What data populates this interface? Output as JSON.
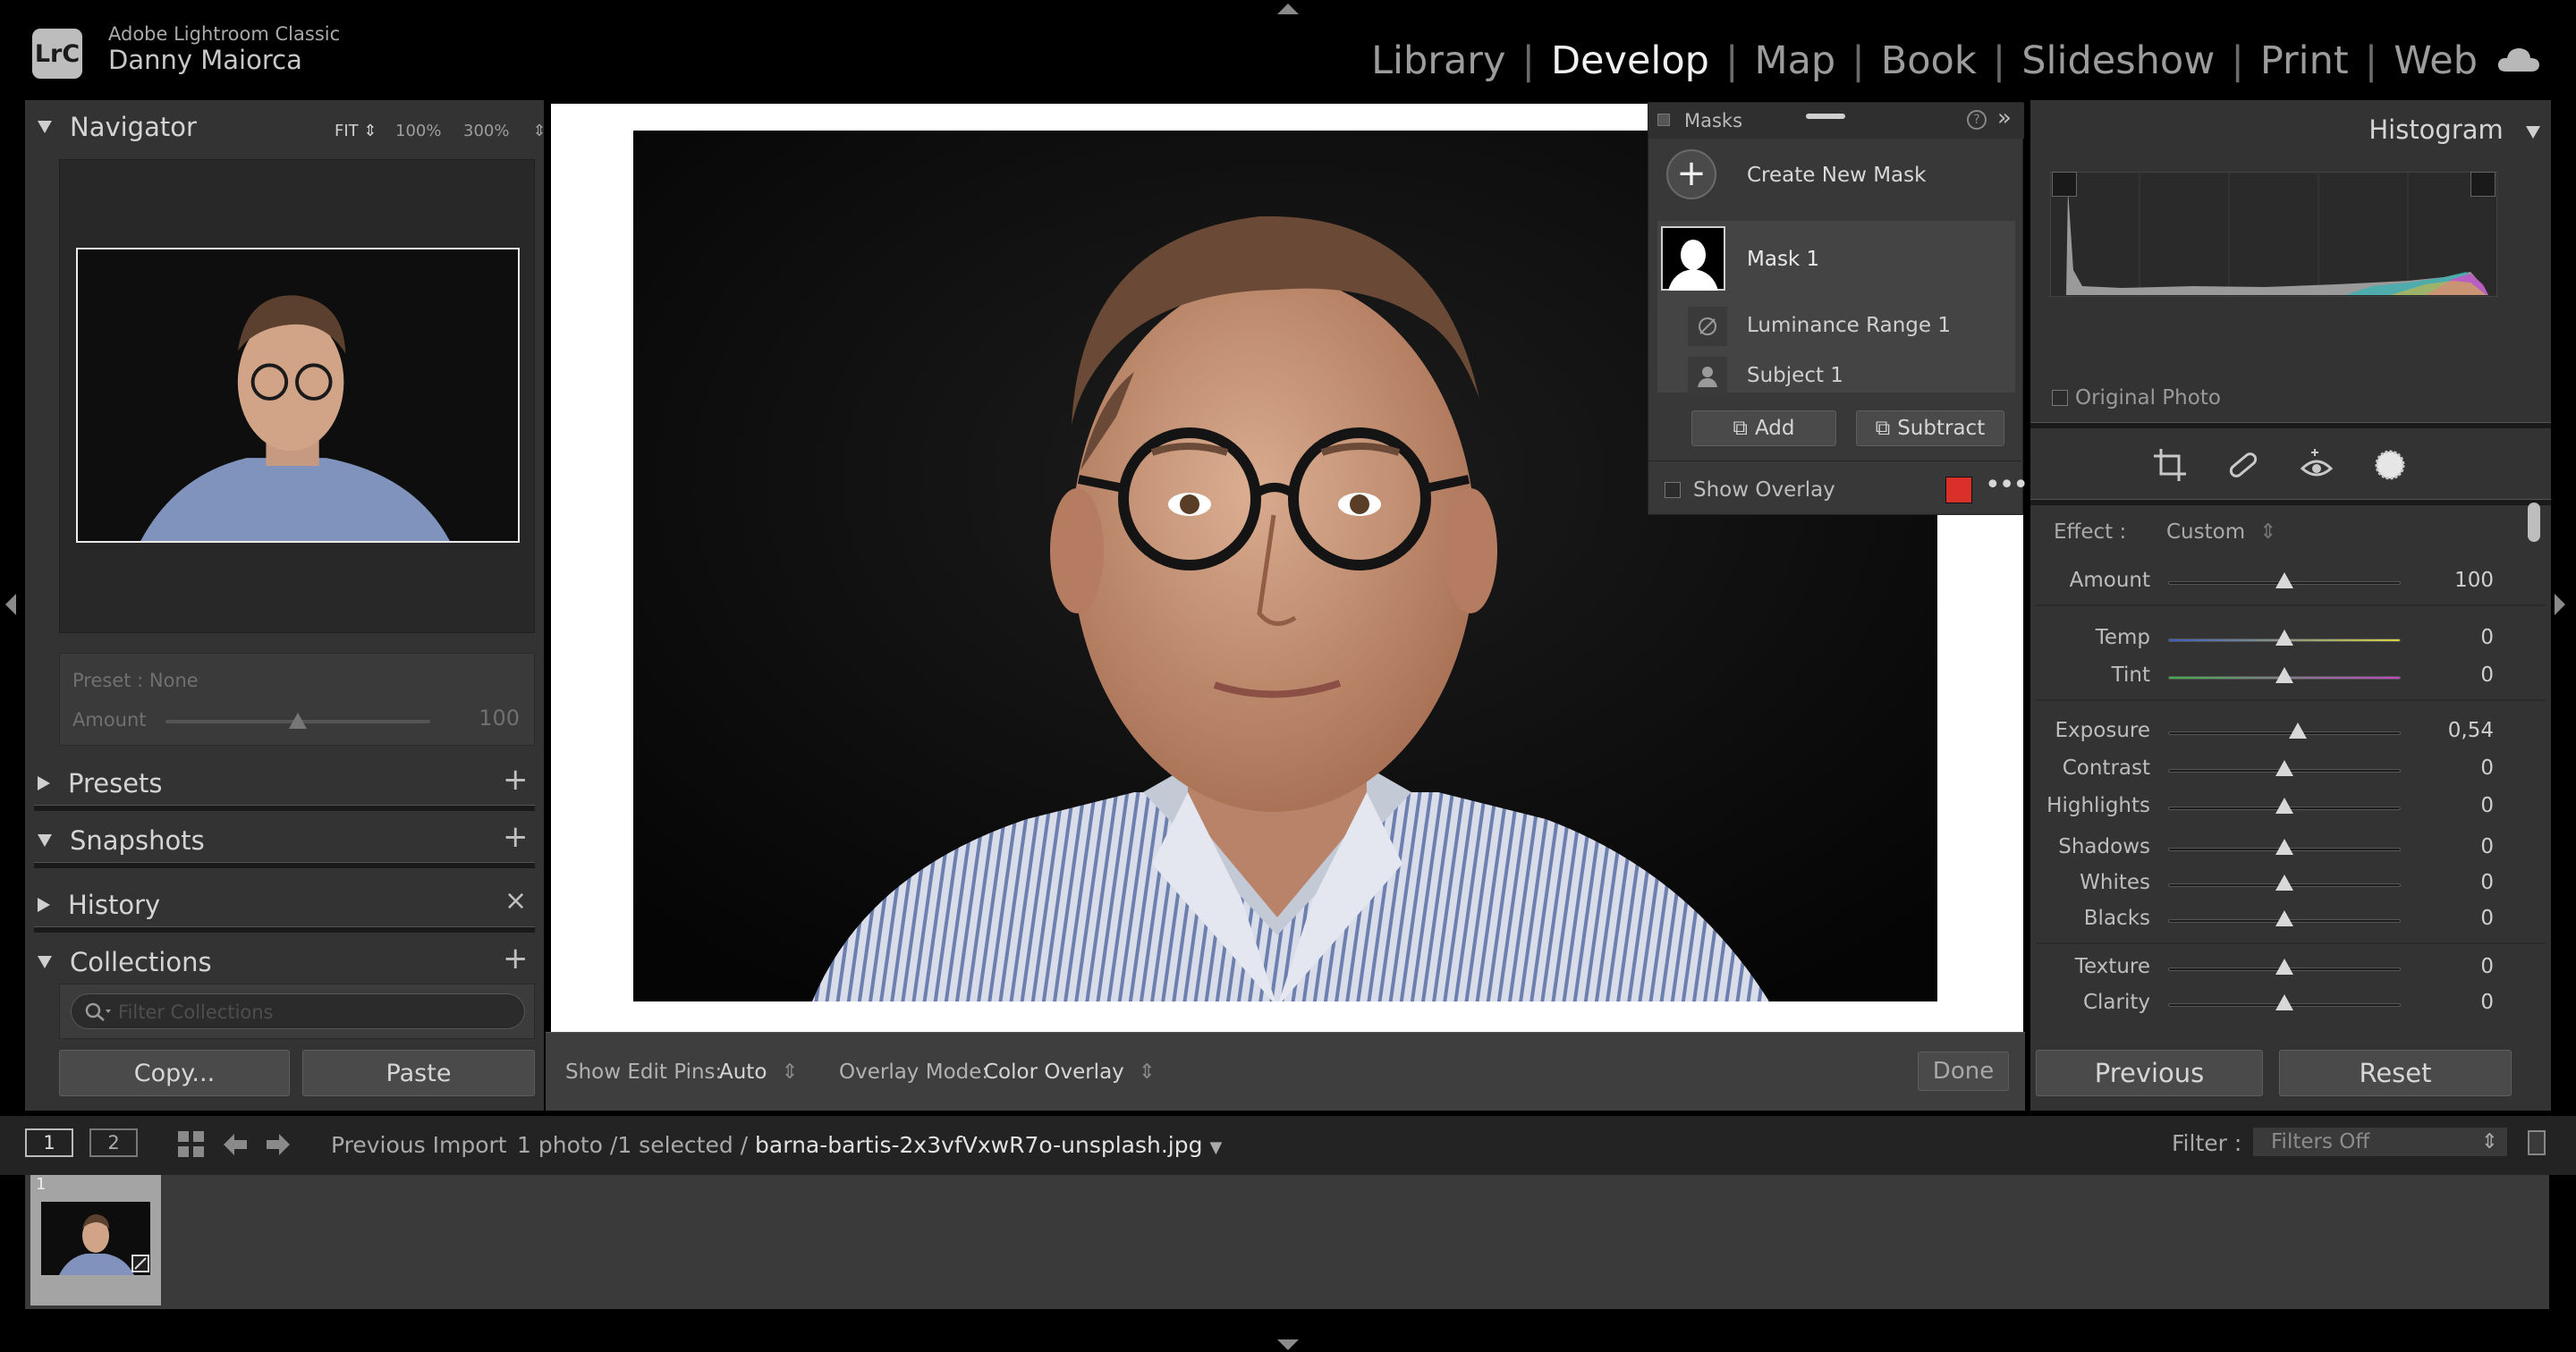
{
  "app": {
    "product_name": "Adobe Lightroom Classic",
    "user_name": "Danny Maiorca",
    "logo_text": "LrC"
  },
  "modules": {
    "items": [
      "Library",
      "Develop",
      "Map",
      "Book",
      "Slideshow",
      "Print",
      "Web"
    ],
    "active": "Develop"
  },
  "navigator": {
    "title": "Navigator",
    "zoom_fit": "FIT",
    "zoom_100": "100%",
    "zoom_300": "300%"
  },
  "preset_box": {
    "label": "Preset : None",
    "amount_label": "Amount",
    "amount_value": "100",
    "amount_fraction": 0.5
  },
  "left_panels": {
    "presets": "Presets",
    "snapshots": "Snapshots",
    "history": "History",
    "collections": "Collections",
    "filter_placeholder": "Filter Collections"
  },
  "left_buttons": {
    "copy": "Copy...",
    "paste": "Paste"
  },
  "masks": {
    "title": "Masks",
    "create_new": "Create New Mask",
    "mask_name": "Mask 1",
    "components": [
      "Luminance Range 1",
      "Subject 1"
    ],
    "add": "Add",
    "subtract": "Subtract",
    "show_overlay": "Show Overlay",
    "overlay_color": "#d9302a"
  },
  "toolbar": {
    "show_edit_pins_label": "Show Edit Pins:",
    "show_edit_pins_value": "Auto",
    "overlay_mode_label": "Overlay Mode:",
    "overlay_mode_value": "Color Overlay",
    "done": "Done"
  },
  "histogram": {
    "title": "Histogram",
    "original_photo": "Original Photo"
  },
  "effect": {
    "label": "Effect :",
    "value": "Custom"
  },
  "sliders": [
    {
      "label": "Amount",
      "value": "100",
      "fraction": 0.5,
      "track": "#1d1d1d"
    },
    {
      "label": "Temp",
      "value": "0",
      "fraction": 0.5,
      "track": "linear-gradient(90deg,#3b5cc4,#d7d23c)"
    },
    {
      "label": "Tint",
      "value": "0",
      "fraction": 0.5,
      "track": "linear-gradient(90deg,#3fb24b,#c244c6)"
    },
    {
      "label": "Exposure",
      "value": "0,54",
      "fraction": 0.556,
      "track": "#1d1d1d"
    },
    {
      "label": "Contrast",
      "value": "0",
      "fraction": 0.5,
      "track": "#1d1d1d"
    },
    {
      "label": "Highlights",
      "value": "0",
      "fraction": 0.5,
      "track": "#1d1d1d"
    },
    {
      "label": "Shadows",
      "value": "0",
      "fraction": 0.5,
      "track": "#1d1d1d"
    },
    {
      "label": "Whites",
      "value": "0",
      "fraction": 0.5,
      "track": "#1d1d1d"
    },
    {
      "label": "Blacks",
      "value": "0",
      "fraction": 0.5,
      "track": "#1d1d1d"
    },
    {
      "label": "Texture",
      "value": "0",
      "fraction": 0.5,
      "track": "#1d1d1d"
    },
    {
      "label": "Clarity",
      "value": "0",
      "fraction": 0.5,
      "track": "#1d1d1d"
    }
  ],
  "right_buttons": {
    "previous": "Previous",
    "reset": "Reset"
  },
  "filmstrip_bar": {
    "screen1": "1",
    "screen2": "2",
    "source": "Previous Import",
    "count": "1 photo /1 selected /",
    "filename": "barna-bartis-2x3vfVxwR7o-unsplash.jpg",
    "filter_label": "Filter :",
    "filter_value": "Filters Off"
  },
  "thumbnail": {
    "index": "1"
  }
}
